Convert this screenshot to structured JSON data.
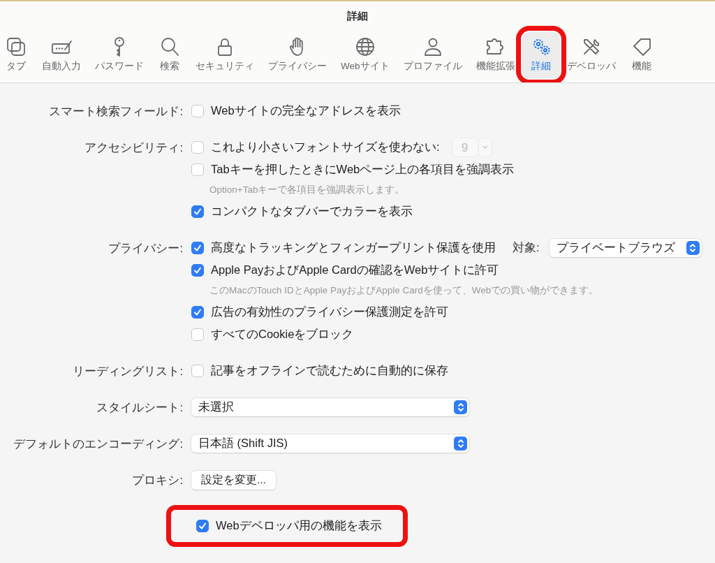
{
  "window": {
    "title": "詳細"
  },
  "toolbar": [
    {
      "label": "タブ",
      "selected": false,
      "highlighted": false
    },
    {
      "label": "自動入力",
      "selected": false,
      "highlighted": false
    },
    {
      "label": "パスワード",
      "selected": false,
      "highlighted": false
    },
    {
      "label": "検索",
      "selected": false,
      "highlighted": false
    },
    {
      "label": "セキュリティ",
      "selected": false,
      "highlighted": false
    },
    {
      "label": "プライバシー",
      "selected": false,
      "highlighted": false
    },
    {
      "label": "Webサイト",
      "selected": false,
      "highlighted": false
    },
    {
      "label": "プロファイル",
      "selected": false,
      "highlighted": false
    },
    {
      "label": "機能拡張",
      "selected": false,
      "highlighted": false
    },
    {
      "label": "詳細",
      "selected": true,
      "highlighted": true
    },
    {
      "label": "デベロッパ",
      "selected": false,
      "highlighted": false
    },
    {
      "label": "機能",
      "selected": false,
      "highlighted": false
    }
  ],
  "sections": [
    {
      "label": "スマート検索フィールド:",
      "items": [
        {
          "kind": "checkbox",
          "label": "Webサイトの完全なアドレスを表示",
          "checked": false,
          "highlighted": false
        }
      ]
    },
    {
      "label": "アクセシビリティ:",
      "items": [
        {
          "kind": "checkbox",
          "label": "これより小さいフォントサイズを使わない:",
          "checked": false,
          "highlighted": false,
          "stepper": {
            "value": "9",
            "disabled": true
          }
        },
        {
          "kind": "checkbox",
          "label": "Tabキーを押したときにWebページ上の各項目を強調表示",
          "checked": false,
          "highlighted": false
        },
        {
          "kind": "note",
          "label": "Option+Tabキーで各項目を強調表示します。"
        },
        {
          "kind": "checkbox",
          "label": "コンパクトなタブバーでカラーを表示",
          "checked": true,
          "highlighted": false
        }
      ]
    },
    {
      "label": "プライバシー:",
      "items": [
        {
          "kind": "checkbox",
          "label": "高度なトラッキングとフィンガープリント保護を使用",
          "checked": true,
          "highlighted": false,
          "target": {
            "label": "対象:",
            "value": "プライベートブラウズ"
          }
        },
        {
          "kind": "checkbox",
          "label": "Apple PayおよびApple Cardの確認をWebサイトに許可",
          "checked": true,
          "highlighted": false
        },
        {
          "kind": "note",
          "label": "このMacのTouch IDとApple PayおよびApple Cardを使って、Webでの買い物ができます。"
        },
        {
          "kind": "checkbox",
          "label": "広告の有効性のプライバシー保護測定を許可",
          "checked": true,
          "highlighted": false
        },
        {
          "kind": "checkbox",
          "label": "すべてのCookieをブロック",
          "checked": false,
          "highlighted": false
        }
      ]
    },
    {
      "label": "リーディングリスト:",
      "items": [
        {
          "kind": "checkbox",
          "label": "記事をオフラインで読むために自動的に保存",
          "checked": false,
          "highlighted": false
        }
      ]
    },
    {
      "label": "スタイルシート:",
      "items": [
        {
          "kind": "popup",
          "value": "未選択"
        }
      ]
    },
    {
      "label": "デフォルトのエンコーディング:",
      "items": [
        {
          "kind": "popup",
          "value": "日本語 (Shift JIS)"
        }
      ]
    },
    {
      "label": "プロキシ:",
      "items": [
        {
          "kind": "button",
          "label": "設定を変更..."
        }
      ]
    },
    {
      "items": [
        {
          "kind": "checkbox",
          "label": "Webデベロッパ用の機能を表示",
          "checked": true,
          "highlighted": true
        }
      ]
    }
  ]
}
